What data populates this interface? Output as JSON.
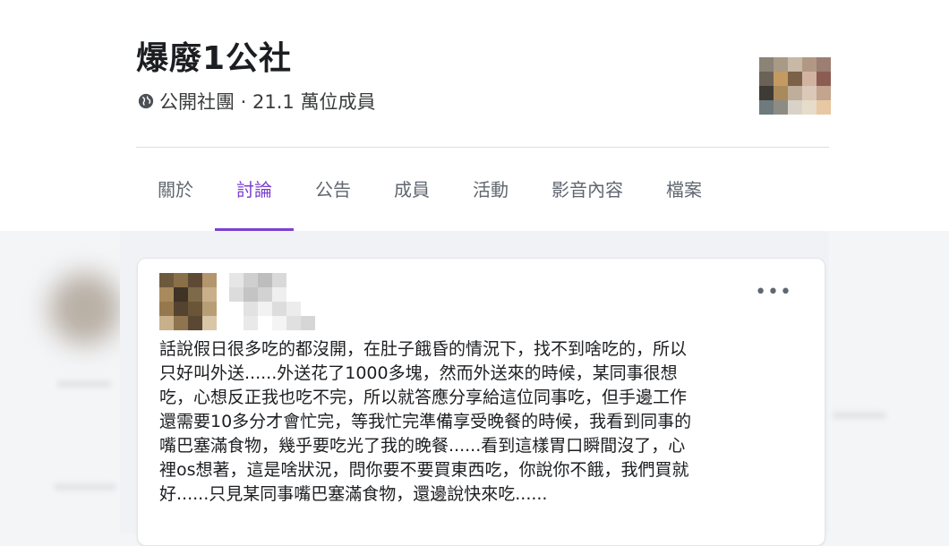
{
  "group": {
    "name": "爆廢1公社",
    "meta": "公開社團 · 21.1 萬位成員"
  },
  "tabs": [
    {
      "label": "關於"
    },
    {
      "label": "討論"
    },
    {
      "label": "公告"
    },
    {
      "label": "成員"
    },
    {
      "label": "活動"
    },
    {
      "label": "影音內容"
    },
    {
      "label": "檔案"
    }
  ],
  "active_tab": "討論",
  "post": {
    "more_label": "•••",
    "lines": [
      "話說假日很多吃的都沒開，在肚子餓昏的情況下，找不到啥吃的，所以",
      "只好叫外送......外送花了1000多塊，然而外送來的時候，某同事很想",
      "吃，心想反正我也吃不完，所以就答應分享給這位同事吃，但手邊工作",
      "還需要10多分才會忙完，等我忙完準備享受晚餐的時候，我看到同事的",
      "嘴巴塞滿食物，幾乎要吃光了我的晚餐......看到這樣胃口瞬間沒了，心",
      "裡os想著，這是啥狀況，問你要不要買東西吃，你說你不餓，我們買就",
      "好......只見某同事嘴巴塞滿食物，還邊說快來吃......"
    ]
  },
  "colors": {
    "accent": "#7b3fd0",
    "text": "#1c1e21",
    "muted": "#606770",
    "background": "#f0f2f5"
  },
  "icons": {
    "meta_icon": "globe-icon",
    "more_icon": "more-dots-icon"
  }
}
